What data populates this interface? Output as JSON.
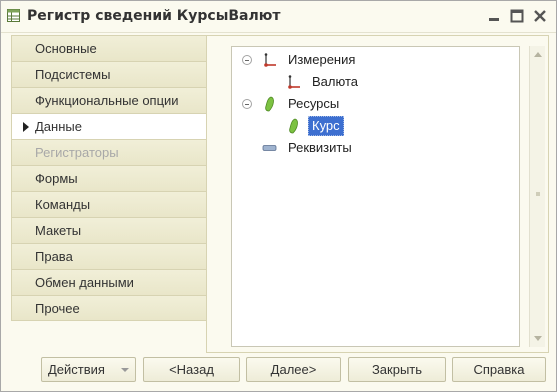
{
  "window": {
    "title": "Регистр сведений КурсыВалют"
  },
  "tabs": [
    {
      "label": "Основные",
      "state": "normal"
    },
    {
      "label": "Подсистемы",
      "state": "normal"
    },
    {
      "label": "Функциональные опции",
      "state": "normal"
    },
    {
      "label": "Данные",
      "state": "active"
    },
    {
      "label": "Регистраторы",
      "state": "disabled"
    },
    {
      "label": "Формы",
      "state": "normal"
    },
    {
      "label": "Команды",
      "state": "normal"
    },
    {
      "label": "Макеты",
      "state": "normal"
    },
    {
      "label": "Права",
      "state": "normal"
    },
    {
      "label": "Обмен данными",
      "state": "normal"
    },
    {
      "label": "Прочее",
      "state": "normal"
    }
  ],
  "tree": {
    "dimensions": {
      "label": "Измерения",
      "icon": "dimension-icon",
      "expanded": true
    },
    "dimension_item": {
      "label": "Валюта",
      "icon": "dimension-icon"
    },
    "resources": {
      "label": "Ресурсы",
      "icon": "resource-icon",
      "expanded": true
    },
    "resource_item": {
      "label": "Курс",
      "icon": "resource-icon",
      "selected": true
    },
    "attributes": {
      "label": "Реквизиты",
      "icon": "attribute-icon"
    }
  },
  "footer": {
    "actions_label": "Действия",
    "back_label": "<Назад",
    "next_label": "Далее>",
    "close_label": "Закрыть",
    "help_label": "Справка"
  },
  "colors": {
    "background": "#fbfaef",
    "tab": "#ece9cf",
    "selection": "#3d6fd0"
  }
}
